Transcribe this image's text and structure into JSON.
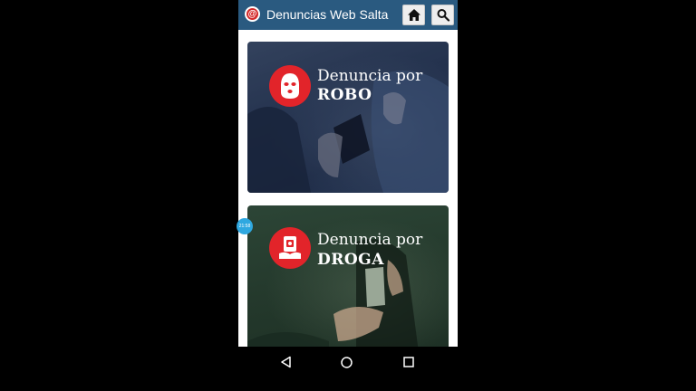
{
  "app": {
    "logo_glyph": "@",
    "title": "Denuncias Web Salta",
    "colors": {
      "appbar": "#2a5a80",
      "badge": "#e2242a",
      "bubble": "#2fa8e0"
    }
  },
  "toolbar": {
    "home_icon": "home-icon",
    "search_icon": "search-icon"
  },
  "cards": [
    {
      "line1": "Denuncia por",
      "line2": "ROBO",
      "icon": "balaclava-icon"
    },
    {
      "line1": "Denuncia por",
      "line2": "DROGA",
      "icon": "drug-package-icon"
    }
  ],
  "floating_bubble": {
    "text": "21:58"
  },
  "navbar": {
    "icons": [
      "back-icon",
      "home-circle-icon",
      "recents-icon"
    ]
  }
}
